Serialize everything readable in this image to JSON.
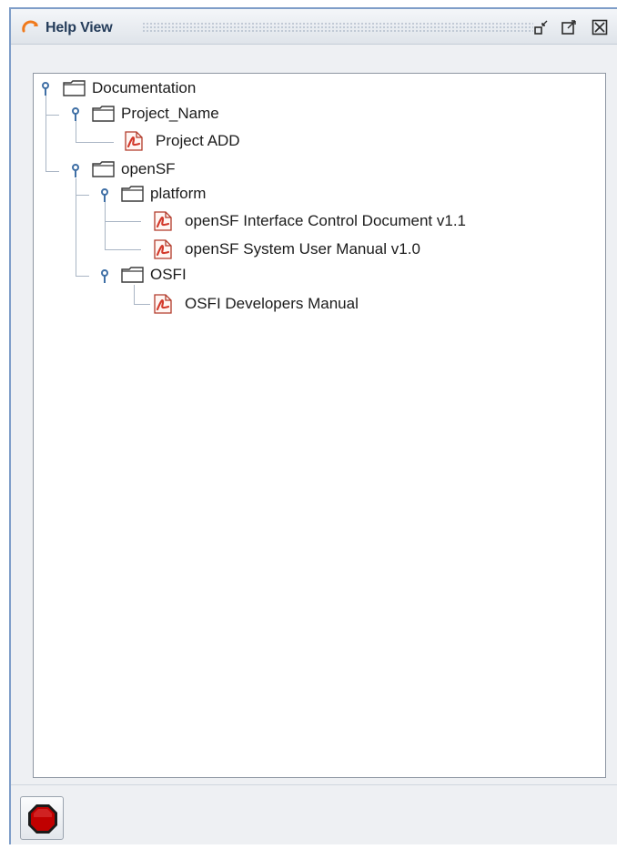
{
  "window": {
    "title": "Help View"
  },
  "tree": {
    "root": {
      "label": "Documentation"
    },
    "project_name": {
      "label": "Project_Name"
    },
    "project_add": {
      "label": "Project ADD"
    },
    "opensf": {
      "label": "openSF"
    },
    "platform": {
      "label": "platform"
    },
    "icd": {
      "label": "openSF Interface Control Document v1.1"
    },
    "sum": {
      "label": "openSF System User Manual v1.0"
    },
    "osfi": {
      "label": "OSFI"
    },
    "osfi_manual": {
      "label": "OSFI Developers Manual"
    }
  },
  "icons": {
    "title": "help-view-icon",
    "minimize": "minimize-icon",
    "maximize": "maximize-icon",
    "close": "close-icon",
    "folder": "folder-icon",
    "pdf": "pdf-icon",
    "expander": "tree-expander-icon",
    "stop": "stop-icon"
  },
  "colors": {
    "title_text": "#243c5a",
    "window_border": "#7e9dc8",
    "tree_line": "#a9b5c4",
    "pdf_red": "#d33a2c",
    "stop_red": "#c00000"
  }
}
